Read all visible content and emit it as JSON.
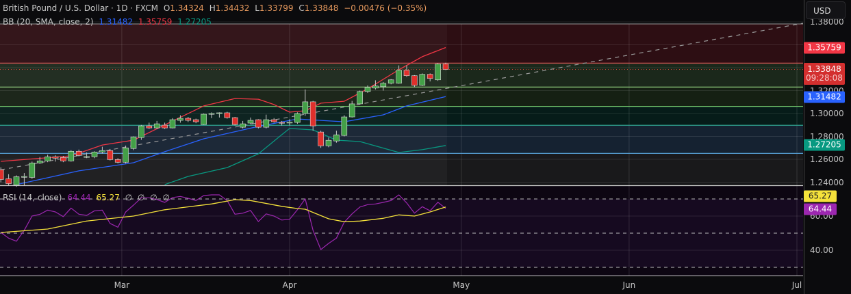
{
  "legend": {
    "symbol": "British Pound / U.S. Dollar · 1D · FXCM",
    "open_label": "O",
    "open": "1.34324",
    "high_label": "H",
    "high": "1.34432",
    "low_label": "L",
    "low": "1.33799",
    "close_label": "C",
    "close": "1.33848",
    "change": "−0.00476 (−0.35%)",
    "bb_title": "BB (20, SMA, close, 2)",
    "bb_basis": "1.31482",
    "bb_upper": "1.35759",
    "bb_lower": "1.27205",
    "rsi_title": "RSI (14, close)",
    "rsi_value": "64.44",
    "rsi_ma": "65.27",
    "rsi_extra": [
      "∅",
      "∅",
      "∅",
      "∅"
    ]
  },
  "currency_button": "USD",
  "price_axis": {
    "ticks": [
      "1.38000",
      "1.32000",
      "1.30000",
      "1.28000",
      "1.26000",
      "1.24000"
    ],
    "tick_values": [
      1.38,
      1.32,
      1.3,
      1.28,
      1.26,
      1.24
    ],
    "upper_label": "1.35759",
    "current_price": "1.33848",
    "countdown": "09:28:08",
    "basis_label": "1.31482",
    "lower_label": "1.27205"
  },
  "rsi_axis": {
    "ticks": [
      "60.00",
      "40.00"
    ],
    "tick_values": [
      60,
      40
    ],
    "ma_label": "65.27",
    "rsi_label": "64.44"
  },
  "time_axis": [
    {
      "label": "Mar",
      "date": "2025-03-01"
    },
    {
      "label": "Apr",
      "date": "2025-04-01"
    },
    {
      "label": "May",
      "date": "2025-05-01"
    },
    {
      "label": "Jun",
      "date": "2025-06-01"
    },
    {
      "label": "Jul",
      "date": "2025-07-01"
    }
  ],
  "colors": {
    "up": "#43a047",
    "down": "#e0302c",
    "bb_upper": "#f23645",
    "bb_basis": "#2962ff",
    "bb_lower": "#089981",
    "rsi": "#9c27b0",
    "rsi_ma": "#f5e23b",
    "current": "#d32f2f"
  },
  "chart_data": {
    "type": "candlestick",
    "interval": "1D",
    "candles_fields": [
      "date",
      "open",
      "high",
      "low",
      "close"
    ],
    "candles": [
      [
        "2025-02-07",
        1.2508,
        1.253,
        1.24,
        1.2424
      ],
      [
        "2025-02-10",
        1.243,
        1.247,
        1.237,
        1.2388
      ],
      [
        "2025-02-11",
        1.2376,
        1.246,
        1.236,
        1.2448
      ],
      [
        "2025-02-12",
        1.2448,
        1.248,
        1.237,
        1.245
      ],
      [
        "2025-02-13",
        1.2442,
        1.258,
        1.243,
        1.2568
      ],
      [
        "2025-02-14",
        1.2568,
        1.262,
        1.256,
        1.2586
      ],
      [
        "2025-02-17",
        1.2586,
        1.264,
        1.2575,
        1.2622
      ],
      [
        "2025-02-18",
        1.2622,
        1.2635,
        1.258,
        1.261
      ],
      [
        "2025-02-19",
        1.2616,
        1.263,
        1.2575,
        1.2586
      ],
      [
        "2025-02-20",
        1.2586,
        1.268,
        1.258,
        1.267
      ],
      [
        "2025-02-21",
        1.267,
        1.2685,
        1.2625,
        1.2634
      ],
      [
        "2025-02-24",
        1.2622,
        1.266,
        1.261,
        1.2624
      ],
      [
        "2025-02-25",
        1.2622,
        1.267,
        1.261,
        1.2664
      ],
      [
        "2025-02-26",
        1.2664,
        1.271,
        1.265,
        1.2676
      ],
      [
        "2025-02-27",
        1.2676,
        1.269,
        1.259,
        1.2598
      ],
      [
        "2025-02-28",
        1.2598,
        1.261,
        1.2565,
        1.2574
      ],
      [
        "2025-03-03",
        1.2574,
        1.272,
        1.2565,
        1.27
      ],
      [
        "2025-03-04",
        1.2694,
        1.28,
        1.268,
        1.2796
      ],
      [
        "2025-03-05",
        1.279,
        1.29,
        1.277,
        1.2892
      ],
      [
        "2025-03-06",
        1.2892,
        1.292,
        1.2865,
        1.2874
      ],
      [
        "2025-03-07",
        1.2874,
        1.2935,
        1.2865,
        1.291
      ],
      [
        "2025-03-10",
        1.2898,
        1.292,
        1.2865,
        1.2874
      ],
      [
        "2025-03-11",
        1.2874,
        1.296,
        1.287,
        1.2946
      ],
      [
        "2025-03-12",
        1.294,
        1.2985,
        1.292,
        1.2958
      ],
      [
        "2025-03-13",
        1.2958,
        1.297,
        1.2925,
        1.294
      ],
      [
        "2025-03-14",
        1.2946,
        1.2955,
        1.2915,
        1.2928
      ],
      [
        "2025-03-17",
        1.2904,
        1.3,
        1.29,
        1.2994
      ],
      [
        "2025-03-18",
        1.2994,
        1.301,
        1.296,
        1.3
      ],
      [
        "2025-03-19",
        1.3,
        1.301,
        1.2965,
        1.3006
      ],
      [
        "2025-03-20",
        1.3006,
        1.3015,
        1.2955,
        1.2964
      ],
      [
        "2025-03-21",
        1.2964,
        1.297,
        1.2895,
        1.2904
      ],
      [
        "2025-03-24",
        1.288,
        1.2935,
        1.287,
        1.291
      ],
      [
        "2025-03-25",
        1.2916,
        1.2965,
        1.2905,
        1.294
      ],
      [
        "2025-03-26",
        1.2946,
        1.295,
        1.287,
        1.288
      ],
      [
        "2025-03-27",
        1.288,
        1.299,
        1.287,
        1.2946
      ],
      [
        "2025-03-28",
        1.2946,
        1.296,
        1.292,
        1.2928
      ],
      [
        "2025-03-31",
        1.2922,
        1.2935,
        1.2895,
        1.2916
      ],
      [
        "2025-04-01",
        1.2922,
        1.295,
        1.2895,
        1.2924
      ],
      [
        "2025-04-02",
        1.2922,
        1.301,
        1.291,
        1.3
      ],
      [
        "2025-04-03",
        1.3,
        1.321,
        1.298,
        1.3102
      ],
      [
        "2025-04-04",
        1.3102,
        1.311,
        1.285,
        1.2892
      ],
      [
        "2025-04-07",
        1.2838,
        1.285,
        1.27,
        1.2718
      ],
      [
        "2025-04-08",
        1.2718,
        1.279,
        1.2705,
        1.2766
      ],
      [
        "2025-04-09",
        1.276,
        1.285,
        1.2745,
        1.2814
      ],
      [
        "2025-04-10",
        1.2808,
        1.2985,
        1.28,
        1.297
      ],
      [
        "2025-04-11",
        1.297,
        1.311,
        1.2965,
        1.3084
      ],
      [
        "2025-04-14",
        1.3084,
        1.32,
        1.308,
        1.3192
      ],
      [
        "2025-04-15",
        1.3192,
        1.3245,
        1.318,
        1.3228
      ],
      [
        "2025-04-16",
        1.3222,
        1.329,
        1.321,
        1.324
      ],
      [
        "2025-04-17",
        1.3234,
        1.3275,
        1.32,
        1.3264
      ],
      [
        "2025-04-18",
        1.3264,
        1.33,
        1.3255,
        1.3294
      ],
      [
        "2025-04-21",
        1.3264,
        1.342,
        1.326,
        1.3378
      ],
      [
        "2025-04-22",
        1.3378,
        1.342,
        1.332,
        1.333
      ],
      [
        "2025-04-23",
        1.333,
        1.3335,
        1.323,
        1.3246
      ],
      [
        "2025-04-24",
        1.3246,
        1.335,
        1.324,
        1.3342
      ],
      [
        "2025-04-25",
        1.3342,
        1.335,
        1.328,
        1.3306
      ],
      [
        "2025-04-28",
        1.3294,
        1.344,
        1.3285,
        1.3432
      ],
      [
        "2025-04-29",
        1.34324,
        1.34432,
        1.33799,
        1.33848
      ]
    ],
    "bollinger": {
      "params": "20, SMA, close, 2",
      "upper": [
        [
          "2025-02-07",
          1.2582
        ],
        [
          "2025-02-20",
          1.263
        ],
        [
          "2025-02-26",
          1.2725
        ],
        [
          "2025-03-04",
          1.2767
        ],
        [
          "2025-03-17",
          1.3066
        ],
        [
          "2025-03-21",
          1.3131
        ],
        [
          "2025-03-26",
          1.3125
        ],
        [
          "2025-03-28",
          1.3078
        ],
        [
          "2025-04-01",
          1.3012
        ],
        [
          "2025-04-03",
          1.3024
        ],
        [
          "2025-04-07",
          1.309
        ],
        [
          "2025-04-10",
          1.3107
        ],
        [
          "2025-04-15",
          1.3215
        ],
        [
          "2025-04-21",
          1.3382
        ],
        [
          "2025-04-24",
          1.3496
        ],
        [
          "2025-04-29",
          1.35759
        ]
      ],
      "basis": [
        [
          "2025-02-11",
          1.2379
        ],
        [
          "2025-02-21",
          1.2499
        ],
        [
          "2025-03-04",
          1.257
        ],
        [
          "2025-03-10",
          1.2666
        ],
        [
          "2025-03-17",
          1.2779
        ],
        [
          "2025-03-26",
          1.2887
        ],
        [
          "2025-04-02",
          1.2952
        ],
        [
          "2025-04-07",
          1.294
        ],
        [
          "2025-04-10",
          1.2928
        ],
        [
          "2025-04-17",
          1.2988
        ],
        [
          "2025-04-22",
          1.3066
        ],
        [
          "2025-04-29",
          1.31482
        ]
      ],
      "lower": [
        [
          "2025-03-10",
          1.2379
        ],
        [
          "2025-03-13",
          1.2451
        ],
        [
          "2025-03-20",
          1.2528
        ],
        [
          "2025-03-26",
          1.2648
        ],
        [
          "2025-03-31",
          1.2815
        ],
        [
          "2025-04-01",
          1.2869
        ],
        [
          "2025-04-04",
          1.2857
        ],
        [
          "2025-04-09",
          1.2767
        ],
        [
          "2025-04-14",
          1.2755
        ],
        [
          "2025-04-21",
          1.266
        ],
        [
          "2025-04-24",
          1.2684
        ],
        [
          "2025-04-29",
          1.27205
        ]
      ]
    },
    "horizontal_levels": [
      1.344,
      1.3231,
      1.3062,
      1.2897,
      1.2652
    ],
    "trendline": [
      [
        "2025-02-07",
        1.2508
      ],
      [
        "2025-04-29",
        1.3218
      ]
    ],
    "rsi": [
      50.4,
      47.1,
      45.3,
      51.7,
      60,
      61,
      63.5,
      62.4,
      59.7,
      64.7,
      61.1,
      60.4,
      63.1,
      63.5,
      55.7,
      53.5,
      62.4,
      66.4,
      70.7,
      70.7,
      69.7,
      68,
      70.8,
      71.5,
      70.4,
      69.1,
      72,
      72.4,
      72.4,
      69.1,
      61.1,
      61.7,
      63.3,
      56.8,
      61.3,
      60,
      57.7,
      58.1,
      63.7,
      70.1,
      51.7,
      40.4,
      44,
      47.1,
      56.4,
      61.3,
      65.3,
      66.7,
      67.1,
      68,
      69.1,
      72.4,
      67.7,
      61.7,
      65.5,
      63.1,
      68.1,
      64.44
    ],
    "rsi_ma": [
      [
        "2025-02-07",
        50.4
      ],
      [
        "2025-02-17",
        52.4
      ],
      [
        "2025-02-24",
        57.1
      ],
      [
        "2025-03-04",
        60
      ],
      [
        "2025-03-10",
        63.7
      ],
      [
        "2025-03-18",
        67.1
      ],
      [
        "2025-03-21",
        69.6
      ],
      [
        "2025-03-25",
        69.1
      ],
      [
        "2025-03-31",
        65.7
      ],
      [
        "2025-04-02",
        64.4
      ],
      [
        "2025-04-03",
        64
      ],
      [
        "2025-04-08",
        58.4
      ],
      [
        "2025-04-10",
        56.7
      ],
      [
        "2025-04-14",
        57.1
      ],
      [
        "2025-04-17",
        58.7
      ],
      [
        "2025-04-21",
        60.7
      ],
      [
        "2025-04-23",
        60
      ],
      [
        "2025-04-25",
        62.4
      ],
      [
        "2025-04-29",
        65.27
      ]
    ],
    "rsi_levels": [
      70,
      50,
      30
    ],
    "price_range": [
      1.23,
      1.385
    ],
    "grid": true
  }
}
